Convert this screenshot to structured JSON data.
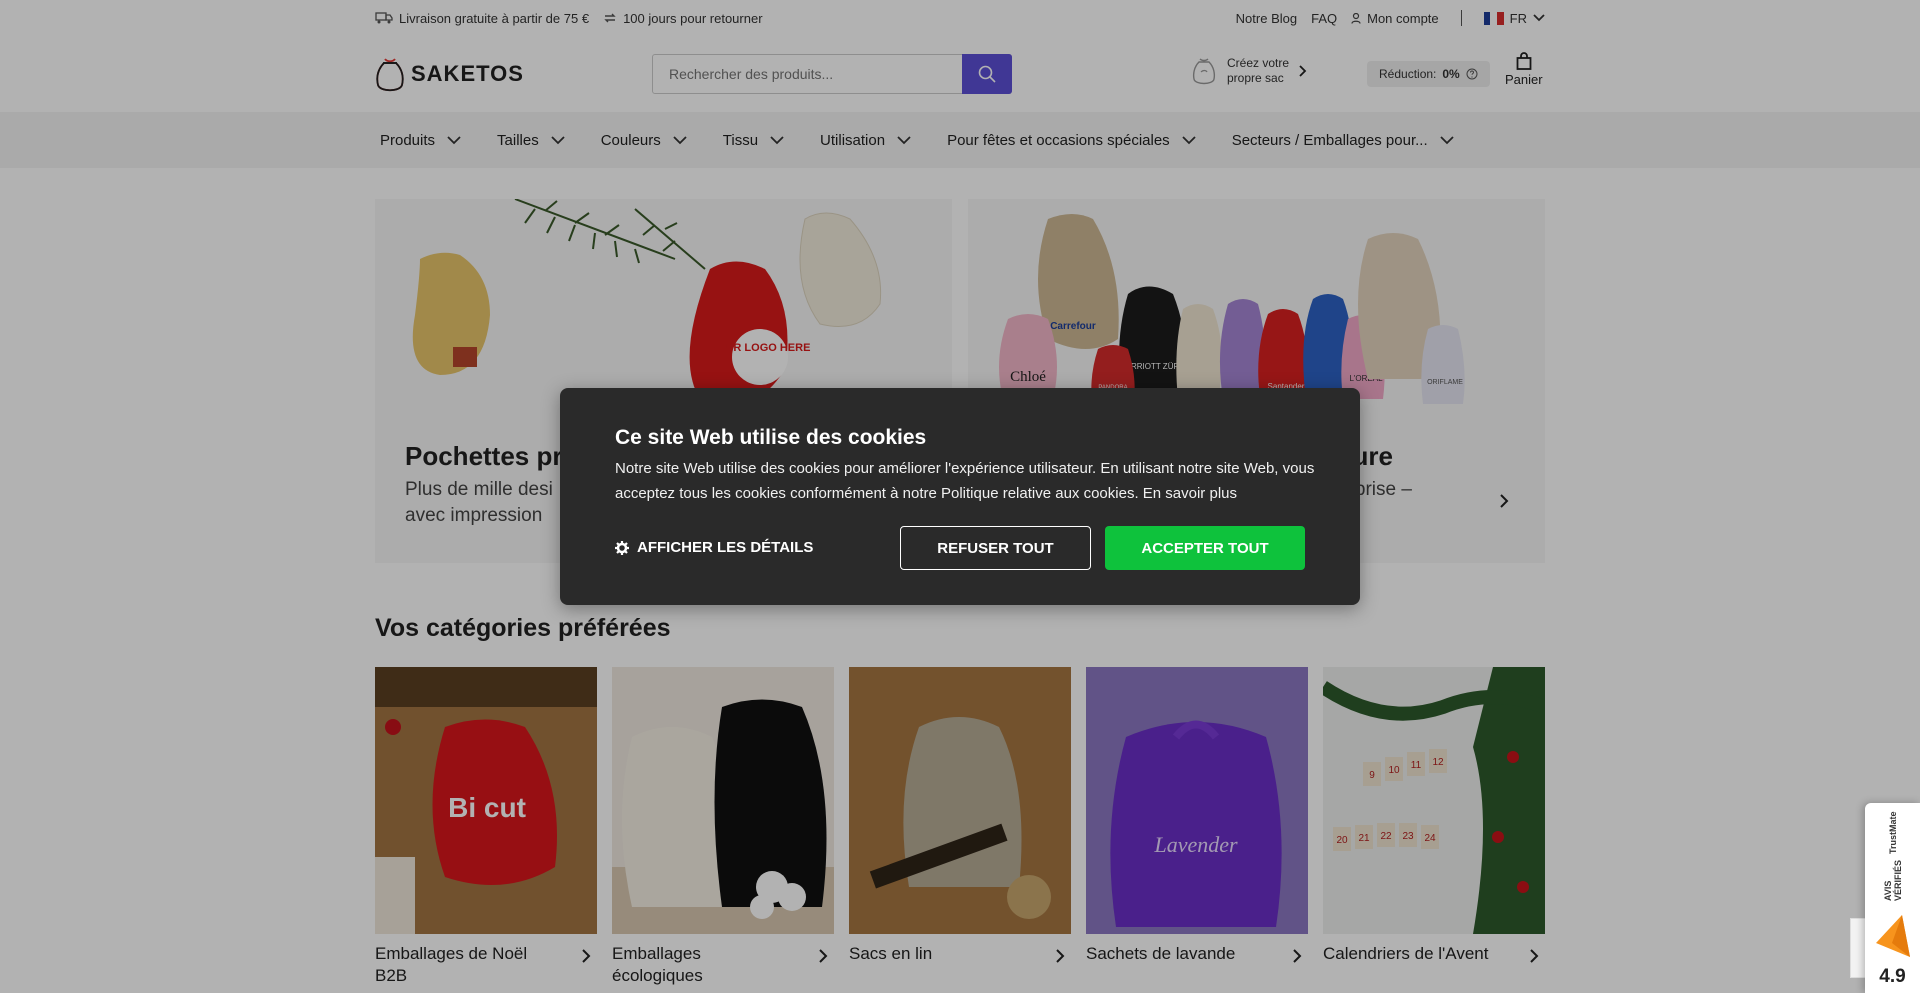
{
  "topbar": {
    "shipping": "Livraison gratuite à partir de 75 €",
    "returns": "100 jours pour retourner",
    "blog": "Notre Blog",
    "faq": "FAQ",
    "account": "Mon compte",
    "language": "FR"
  },
  "header": {
    "logo": "SAKETOS",
    "search_placeholder": "Rechercher des produits...",
    "create_line1": "Créez votre",
    "create_line2": "propre sac",
    "discount_label": "Réduction:",
    "discount_value": "0%",
    "cart": "Panier"
  },
  "nav": {
    "items": [
      {
        "label": "Produits"
      },
      {
        "label": "Tailles"
      },
      {
        "label": "Couleurs"
      },
      {
        "label": "Tissu"
      },
      {
        "label": "Utilisation"
      },
      {
        "label": "Pour fêtes et occasions spéciales"
      },
      {
        "label": "Secteurs / Emballages pour..."
      }
    ]
  },
  "banners": [
    {
      "title": "Pochettes pr",
      "text": "Plus de mille desi\navec impression"
    },
    {
      "title": "sure",
      "text": "reprise –"
    }
  ],
  "banner_logos": [
    "Carrefour",
    "Chloé",
    "MARRIOTT ZÜRICH",
    "Santander",
    "L'ORÉAL",
    "ORIFLAME",
    "PANDORA"
  ],
  "banner_bag_text": "YOUR LOGO HERE",
  "categories": {
    "title": "Vos catégories préférées",
    "items": [
      {
        "label": "Emballages de Noël B2B"
      },
      {
        "label": "Emballages écologiques"
      },
      {
        "label": "Sacs en lin"
      },
      {
        "label": "Sachets de lavande"
      },
      {
        "label": "Calendriers de l'Avent"
      }
    ]
  },
  "category_photo_text": {
    "bicut": "Bi cut",
    "lavender": "Lavender",
    "advent_numbers": [
      "9",
      "10",
      "11",
      "12",
      "20",
      "21",
      "22",
      "23",
      "24"
    ]
  },
  "cookie": {
    "title": "Ce site Web utilise des cookies",
    "text": "Notre site Web utilise des cookies pour améliorer l'expérience utilisateur. En utilisant notre site Web, vous acceptez tous les cookies conformément à notre Politique relative aux cookies. En savoir plus",
    "details": "AFFICHER LES DÉTAILS",
    "refuse": "REFUSER TOUT",
    "accept": "ACCEPTER TOUT"
  },
  "trust": {
    "verified": "AVIS VÉRIFIÉS",
    "brand": "TrustMate",
    "rating": "4.9"
  },
  "colors": {
    "accent": "#5c4fd6",
    "accept_green": "#0ec23c",
    "dialog_bg": "#2a2a2a"
  },
  "icons": [
    "truck-icon",
    "return-icon",
    "user-icon",
    "flag-fr-icon",
    "chevron-down-icon",
    "search-icon",
    "bag-icon",
    "chevron-right-icon",
    "help-icon",
    "cart-icon",
    "gear-icon",
    "star-icon"
  ]
}
